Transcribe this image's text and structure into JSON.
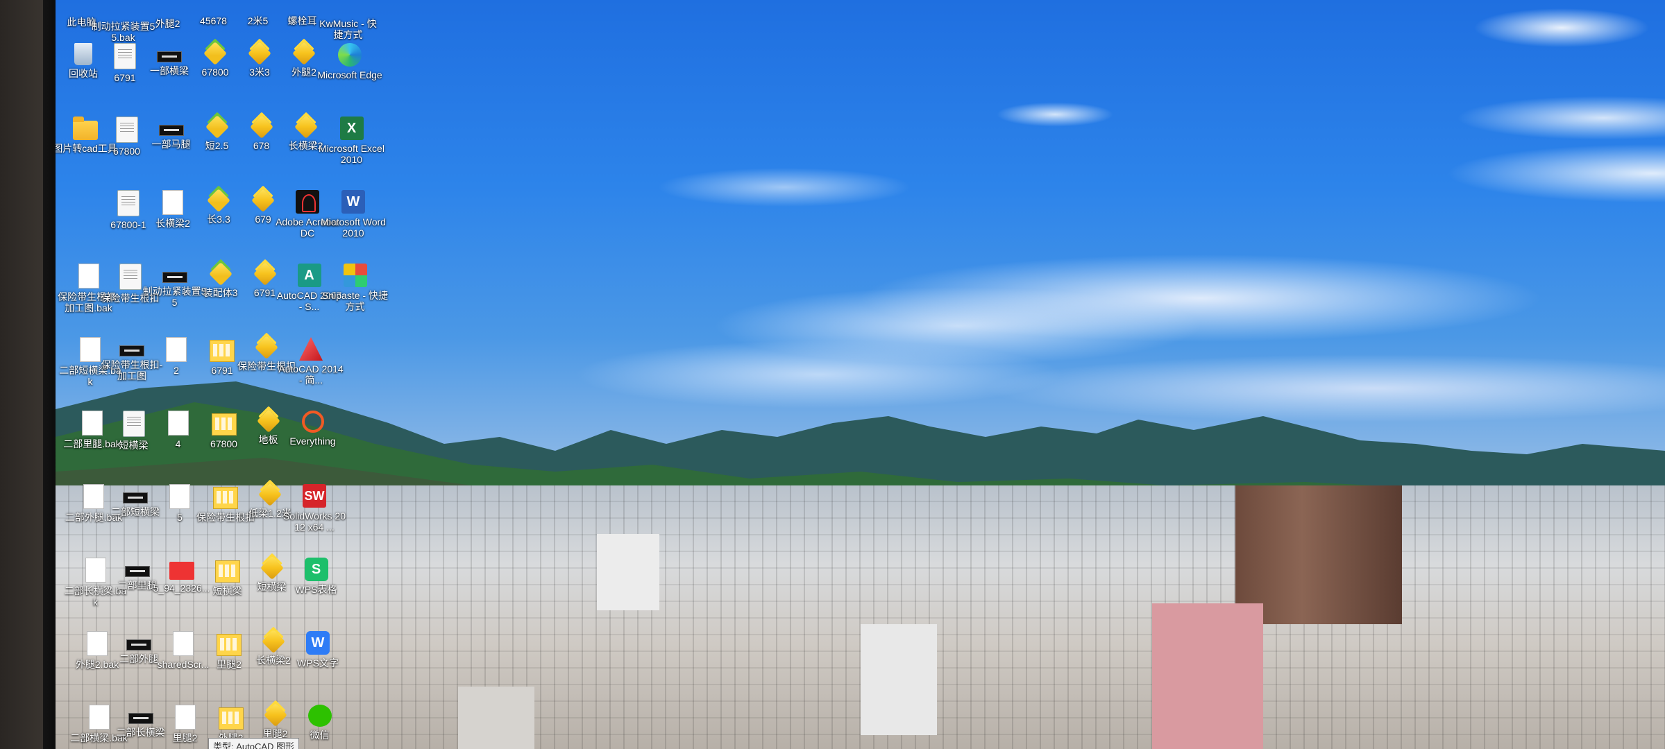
{
  "desktop": {
    "icons": [
      {
        "label": "此电脑",
        "glyph": "g-recycle",
        "name": "this-pc-icon",
        "col": 0,
        "row": -1
      },
      {
        "label": "制动拉紧装置55.bak",
        "glyph": "g-doc",
        "name": "file-icon",
        "col": 1,
        "row": -1
      },
      {
        "label": "外腿2",
        "glyph": "g-folder",
        "name": "folder-icon",
        "col": 2,
        "row": -1
      },
      {
        "label": "45678",
        "glyph": "g-cube",
        "name": "cube-icon",
        "col": 3,
        "row": -1
      },
      {
        "label": "2米5",
        "glyph": "g-cube",
        "name": "cube-icon",
        "col": 4,
        "row": -1
      },
      {
        "label": "螺栓耳",
        "glyph": "g-cube",
        "name": "cube-icon",
        "col": 5,
        "row": -1
      },
      {
        "label": "KwMusic - 快捷方式",
        "glyph": "g-snip",
        "name": "kwmusic-icon",
        "col": 6,
        "row": -1
      },
      {
        "label": "回收站",
        "glyph": "g-recycle",
        "name": "recycle-bin-icon",
        "col": 0,
        "row": 0
      },
      {
        "label": "6791",
        "glyph": "g-doc",
        "name": "document-icon",
        "col": 1,
        "row": 0
      },
      {
        "label": "一部横梁",
        "glyph": "g-dwg",
        "name": "dwg-file-icon",
        "col": 2,
        "row": 0
      },
      {
        "label": "67800",
        "glyph": "g-cube-green",
        "name": "part-icon",
        "col": 3,
        "row": 0
      },
      {
        "label": "3米3",
        "glyph": "g-cube",
        "name": "part-icon",
        "col": 4,
        "row": 0
      },
      {
        "label": "外腿2",
        "glyph": "g-cube",
        "name": "part-icon",
        "col": 5,
        "row": 0
      },
      {
        "label": "Microsoft Edge",
        "glyph": "g-edge",
        "name": "edge-icon",
        "col": 6,
        "row": 0
      },
      {
        "label": "图片转cad工具",
        "glyph": "g-folder",
        "name": "folder-icon",
        "col": 0,
        "row": 1
      },
      {
        "label": "67800",
        "glyph": "g-doc",
        "name": "document-icon",
        "col": 1,
        "row": 1
      },
      {
        "label": "一部马腿",
        "glyph": "g-dwg",
        "name": "dwg-file-icon",
        "col": 2,
        "row": 1
      },
      {
        "label": "短2.5",
        "glyph": "g-cube-green",
        "name": "part-icon",
        "col": 3,
        "row": 1
      },
      {
        "label": "678",
        "glyph": "g-cube",
        "name": "part-icon",
        "col": 4,
        "row": 1
      },
      {
        "label": "长横梁2",
        "glyph": "g-cube",
        "name": "part-icon",
        "col": 5,
        "row": 1
      },
      {
        "label": "Microsoft Excel 2010",
        "glyph": "g-excel",
        "glyph_text": "X",
        "name": "excel-icon",
        "col": 6,
        "row": 1
      },
      {
        "label": "67800-1",
        "glyph": "g-doc",
        "name": "document-icon",
        "col": 1,
        "row": 2
      },
      {
        "label": "长横梁2",
        "glyph": "g-blank",
        "name": "blank-file-icon",
        "col": 2,
        "row": 2
      },
      {
        "label": "长3.3",
        "glyph": "g-cube-green",
        "name": "part-icon",
        "col": 3,
        "row": 2
      },
      {
        "label": "679",
        "glyph": "g-cube",
        "name": "part-icon",
        "col": 4,
        "row": 2
      },
      {
        "label": "Adobe Acrobat DC",
        "glyph": "g-acrobat",
        "name": "acrobat-icon",
        "col": 5,
        "row": 2
      },
      {
        "label": "Microsoft Word 2010",
        "glyph": "g-word",
        "glyph_text": "W",
        "name": "word-icon",
        "col": 6,
        "row": 2
      },
      {
        "label": "保险带生根扣-加工图.bak",
        "glyph": "g-blank",
        "name": "blank-file-icon",
        "col": 0,
        "row": 3
      },
      {
        "label": "保险带生根扣",
        "glyph": "g-doc",
        "name": "document-icon",
        "col": 1,
        "row": 3
      },
      {
        "label": "制动拉紧装置55",
        "glyph": "g-dwg",
        "name": "dwg-file-icon",
        "col": 2,
        "row": 3
      },
      {
        "label": "装配体3",
        "glyph": "g-cube-green",
        "name": "assembly-icon",
        "col": 3,
        "row": 3
      },
      {
        "label": "6791",
        "glyph": "g-cube",
        "name": "part-icon",
        "col": 4,
        "row": 3
      },
      {
        "label": "AutoCAD 2007 - S...",
        "glyph": "g-acad2007",
        "glyph_text": "A",
        "name": "autocad-2007-icon",
        "col": 5,
        "row": 3
      },
      {
        "label": "Snipaste - 快捷方式",
        "glyph": "g-snip",
        "name": "snipaste-icon",
        "col": 6,
        "row": 3
      },
      {
        "label": "二部短横梁.bak",
        "glyph": "g-blank",
        "name": "blank-file-icon",
        "col": 0,
        "row": 4
      },
      {
        "label": "保险带生根扣-加工图",
        "glyph": "g-dwg",
        "name": "dwg-file-icon",
        "col": 1,
        "row": 4
      },
      {
        "label": "2",
        "glyph": "g-blank",
        "name": "blank-file-icon",
        "col": 2,
        "row": 4
      },
      {
        "label": "6791",
        "glyph": "g-yfile",
        "name": "drawing-icon",
        "col": 3,
        "row": 4
      },
      {
        "label": "保险带生根扣",
        "glyph": "g-cube",
        "name": "part-icon",
        "col": 4,
        "row": 4
      },
      {
        "label": "AutoCAD 2014 - 简...",
        "glyph": "g-acad2014",
        "name": "autocad-2014-icon",
        "col": 5,
        "row": 4
      },
      {
        "label": "二部里腿.bak",
        "glyph": "g-blank",
        "name": "blank-file-icon",
        "col": 0,
        "row": 5
      },
      {
        "label": "短横梁",
        "glyph": "g-doc",
        "name": "document-icon",
        "col": 1,
        "row": 5
      },
      {
        "label": "4",
        "glyph": "g-blank",
        "name": "blank-file-icon",
        "col": 2,
        "row": 5
      },
      {
        "label": "67800",
        "glyph": "g-yfile",
        "name": "drawing-icon",
        "col": 3,
        "row": 5
      },
      {
        "label": "地板",
        "glyph": "g-cube",
        "name": "part-icon",
        "col": 4,
        "row": 5
      },
      {
        "label": "Everything",
        "glyph": "g-everything",
        "name": "everything-icon",
        "col": 5,
        "row": 5
      },
      {
        "label": "二部外腿.bak",
        "glyph": "g-blank",
        "name": "blank-file-icon",
        "col": 0,
        "row": 6
      },
      {
        "label": "二部短横梁",
        "glyph": "g-dwg",
        "name": "dwg-file-icon",
        "col": 1,
        "row": 6
      },
      {
        "label": "5",
        "glyph": "g-blank",
        "name": "blank-file-icon",
        "col": 2,
        "row": 6
      },
      {
        "label": "保险带生根扣",
        "glyph": "g-yfile",
        "name": "drawing-icon",
        "col": 3,
        "row": 6
      },
      {
        "label": "低梁1.2米",
        "glyph": "g-cube",
        "name": "part-icon",
        "col": 4,
        "row": 6
      },
      {
        "label": "SolidWorks 2012 x64 ...",
        "glyph": "g-solid",
        "glyph_text": "SW",
        "name": "solidworks-icon",
        "col": 5,
        "row": 6
      },
      {
        "label": "二部长横梁.bak",
        "glyph": "g-blank",
        "name": "blank-file-icon",
        "col": 0,
        "row": 7
      },
      {
        "label": "二部里腿",
        "glyph": "g-dwg",
        "name": "dwg-file-icon",
        "col": 1,
        "row": 7
      },
      {
        "label": "5_94_2326...",
        "glyph": "g-red",
        "name": "image-file-icon",
        "col": 2,
        "row": 7
      },
      {
        "label": "短横梁",
        "glyph": "g-yfile",
        "name": "drawing-icon",
        "col": 3,
        "row": 7
      },
      {
        "label": "短横梁",
        "glyph": "g-cube",
        "name": "part-icon",
        "col": 4,
        "row": 7
      },
      {
        "label": "WPS表格",
        "glyph": "g-wps",
        "glyph_text": "S",
        "name": "wps-spreadsheet-icon",
        "col": 5,
        "row": 7
      },
      {
        "label": "外腿2.bak",
        "glyph": "g-blank",
        "name": "blank-file-icon",
        "col": 0,
        "row": 8
      },
      {
        "label": "二部外腿",
        "glyph": "g-dwg",
        "name": "dwg-file-icon",
        "col": 1,
        "row": 8
      },
      {
        "label": "sharedScr...",
        "glyph": "g-blank",
        "name": "blank-file-icon",
        "col": 2,
        "row": 8
      },
      {
        "label": "里腿2",
        "glyph": "g-yfile",
        "name": "drawing-icon",
        "col": 3,
        "row": 8
      },
      {
        "label": "长横梁2",
        "glyph": "g-cube",
        "name": "part-icon",
        "col": 4,
        "row": 8
      },
      {
        "label": "WPS文字",
        "glyph": "g-wpsw",
        "glyph_text": "W",
        "name": "wps-writer-icon",
        "col": 5,
        "row": 8
      },
      {
        "label": "二部横梁.bak",
        "glyph": "g-blank",
        "name": "blank-file-icon",
        "col": 0,
        "row": 9
      },
      {
        "label": "二部长横梁",
        "glyph": "g-dwg",
        "name": "dwg-file-icon",
        "col": 1,
        "row": 9
      },
      {
        "label": "里腿2",
        "glyph": "g-blank",
        "name": "blank-file-icon",
        "col": 2,
        "row": 9
      },
      {
        "label": "外腿2",
        "glyph": "g-yfile",
        "name": "drawing-icon",
        "col": 3,
        "row": 9
      },
      {
        "label": "里腿2",
        "glyph": "g-cube",
        "name": "part-icon",
        "col": 4,
        "row": 9
      },
      {
        "label": "微信",
        "glyph": "g-wechat",
        "name": "wechat-icon",
        "col": 5,
        "row": 9
      }
    ],
    "tooltip": "类型: AutoCAD 图形"
  }
}
